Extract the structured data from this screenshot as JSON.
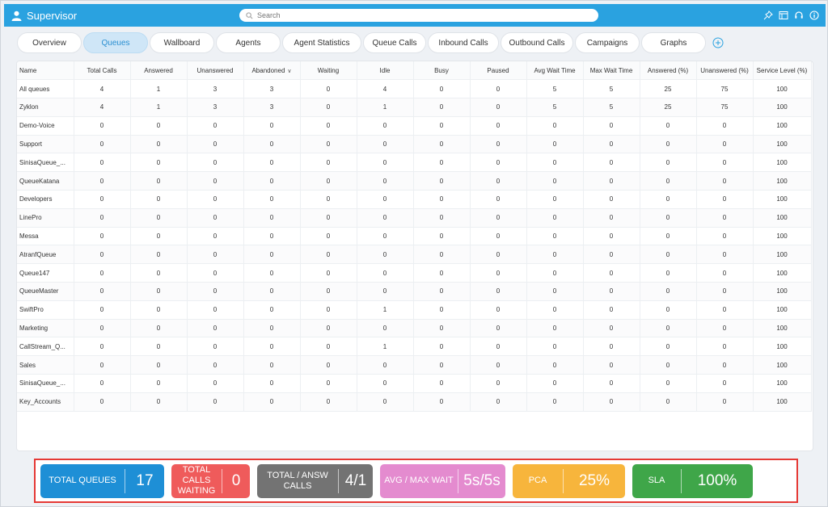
{
  "header": {
    "title": "Supervisor",
    "search_placeholder": "Search",
    "icons": [
      "pin-icon",
      "window-icon",
      "headset-icon",
      "info-icon"
    ]
  },
  "tabs": [
    {
      "label": "Overview",
      "active": false
    },
    {
      "label": "Queues",
      "active": true
    },
    {
      "label": "Wallboard",
      "active": false
    },
    {
      "label": "Agents",
      "active": false
    },
    {
      "label": "Agent Statistics",
      "active": false
    },
    {
      "label": "Queue Calls",
      "active": false
    },
    {
      "label": "Inbound Calls",
      "active": false
    },
    {
      "label": "Outbound Calls",
      "active": false
    },
    {
      "label": "Campaigns",
      "active": false
    },
    {
      "label": "Graphs",
      "active": false
    }
  ],
  "table": {
    "columns": [
      "Name",
      "Total Calls",
      "Answered",
      "Unanswered",
      "Abandoned",
      "Waiting",
      "Idle",
      "Busy",
      "Paused",
      "Avg Wait Time",
      "Max Wait Time",
      "Answered (%)",
      "Unanswered (%)",
      "Service Level (%)"
    ],
    "sorted_column": "Abandoned",
    "rows": [
      [
        "All queues",
        "4",
        "1",
        "3",
        "3",
        "0",
        "4",
        "0",
        "0",
        "5",
        "5",
        "25",
        "75",
        "100"
      ],
      [
        "Zyklon",
        "4",
        "1",
        "3",
        "3",
        "0",
        "1",
        "0",
        "0",
        "5",
        "5",
        "25",
        "75",
        "100"
      ],
      [
        "Demo-Voice",
        "0",
        "0",
        "0",
        "0",
        "0",
        "0",
        "0",
        "0",
        "0",
        "0",
        "0",
        "0",
        "100"
      ],
      [
        "Support",
        "0",
        "0",
        "0",
        "0",
        "0",
        "0",
        "0",
        "0",
        "0",
        "0",
        "0",
        "0",
        "100"
      ],
      [
        "SinisaQueue_...",
        "0",
        "0",
        "0",
        "0",
        "0",
        "0",
        "0",
        "0",
        "0",
        "0",
        "0",
        "0",
        "100"
      ],
      [
        "QueueKatana",
        "0",
        "0",
        "0",
        "0",
        "0",
        "0",
        "0",
        "0",
        "0",
        "0",
        "0",
        "0",
        "100"
      ],
      [
        "Developers",
        "0",
        "0",
        "0",
        "0",
        "0",
        "0",
        "0",
        "0",
        "0",
        "0",
        "0",
        "0",
        "100"
      ],
      [
        "LinePro",
        "0",
        "0",
        "0",
        "0",
        "0",
        "0",
        "0",
        "0",
        "0",
        "0",
        "0",
        "0",
        "100"
      ],
      [
        "Messa",
        "0",
        "0",
        "0",
        "0",
        "0",
        "0",
        "0",
        "0",
        "0",
        "0",
        "0",
        "0",
        "100"
      ],
      [
        "AtranfQueue",
        "0",
        "0",
        "0",
        "0",
        "0",
        "0",
        "0",
        "0",
        "0",
        "0",
        "0",
        "0",
        "100"
      ],
      [
        "Queue147",
        "0",
        "0",
        "0",
        "0",
        "0",
        "0",
        "0",
        "0",
        "0",
        "0",
        "0",
        "0",
        "100"
      ],
      [
        "QueueMaster",
        "0",
        "0",
        "0",
        "0",
        "0",
        "0",
        "0",
        "0",
        "0",
        "0",
        "0",
        "0",
        "100"
      ],
      [
        "SwiftPro",
        "0",
        "0",
        "0",
        "0",
        "0",
        "1",
        "0",
        "0",
        "0",
        "0",
        "0",
        "0",
        "100"
      ],
      [
        "Marketing",
        "0",
        "0",
        "0",
        "0",
        "0",
        "0",
        "0",
        "0",
        "0",
        "0",
        "0",
        "0",
        "100"
      ],
      [
        "CallStream_Q...",
        "0",
        "0",
        "0",
        "0",
        "0",
        "1",
        "0",
        "0",
        "0",
        "0",
        "0",
        "0",
        "100"
      ],
      [
        "Sales",
        "0",
        "0",
        "0",
        "0",
        "0",
        "0",
        "0",
        "0",
        "0",
        "0",
        "0",
        "0",
        "100"
      ],
      [
        "SinisaQueue_...",
        "0",
        "0",
        "0",
        "0",
        "0",
        "0",
        "0",
        "0",
        "0",
        "0",
        "0",
        "0",
        "100"
      ],
      [
        "Key_Accounts",
        "0",
        "0",
        "0",
        "0",
        "0",
        "0",
        "0",
        "0",
        "0",
        "0",
        "0",
        "0",
        "100"
      ]
    ]
  },
  "stats": [
    {
      "name": "total-queues",
      "label": "TOTAL QUEUES",
      "value": "17",
      "color": "#1e8fd6"
    },
    {
      "name": "total-calls-waiting",
      "label": "TOTAL CALLS WAITING",
      "value": "0",
      "color": "#ef5b5b"
    },
    {
      "name": "total-answ-calls",
      "label": "TOTAL / ANSW CALLS",
      "value": "4/1",
      "color": "#737373"
    },
    {
      "name": "avg-max-wait",
      "label": "AVG / MAX WAIT",
      "value": "5s/5s",
      "color": "#e48bcf"
    },
    {
      "name": "pca",
      "label": "PCA",
      "value": "25%",
      "color": "#f7b53c"
    },
    {
      "name": "sla",
      "label": "SLA",
      "value": "100%",
      "color": "#3fa649"
    }
  ]
}
